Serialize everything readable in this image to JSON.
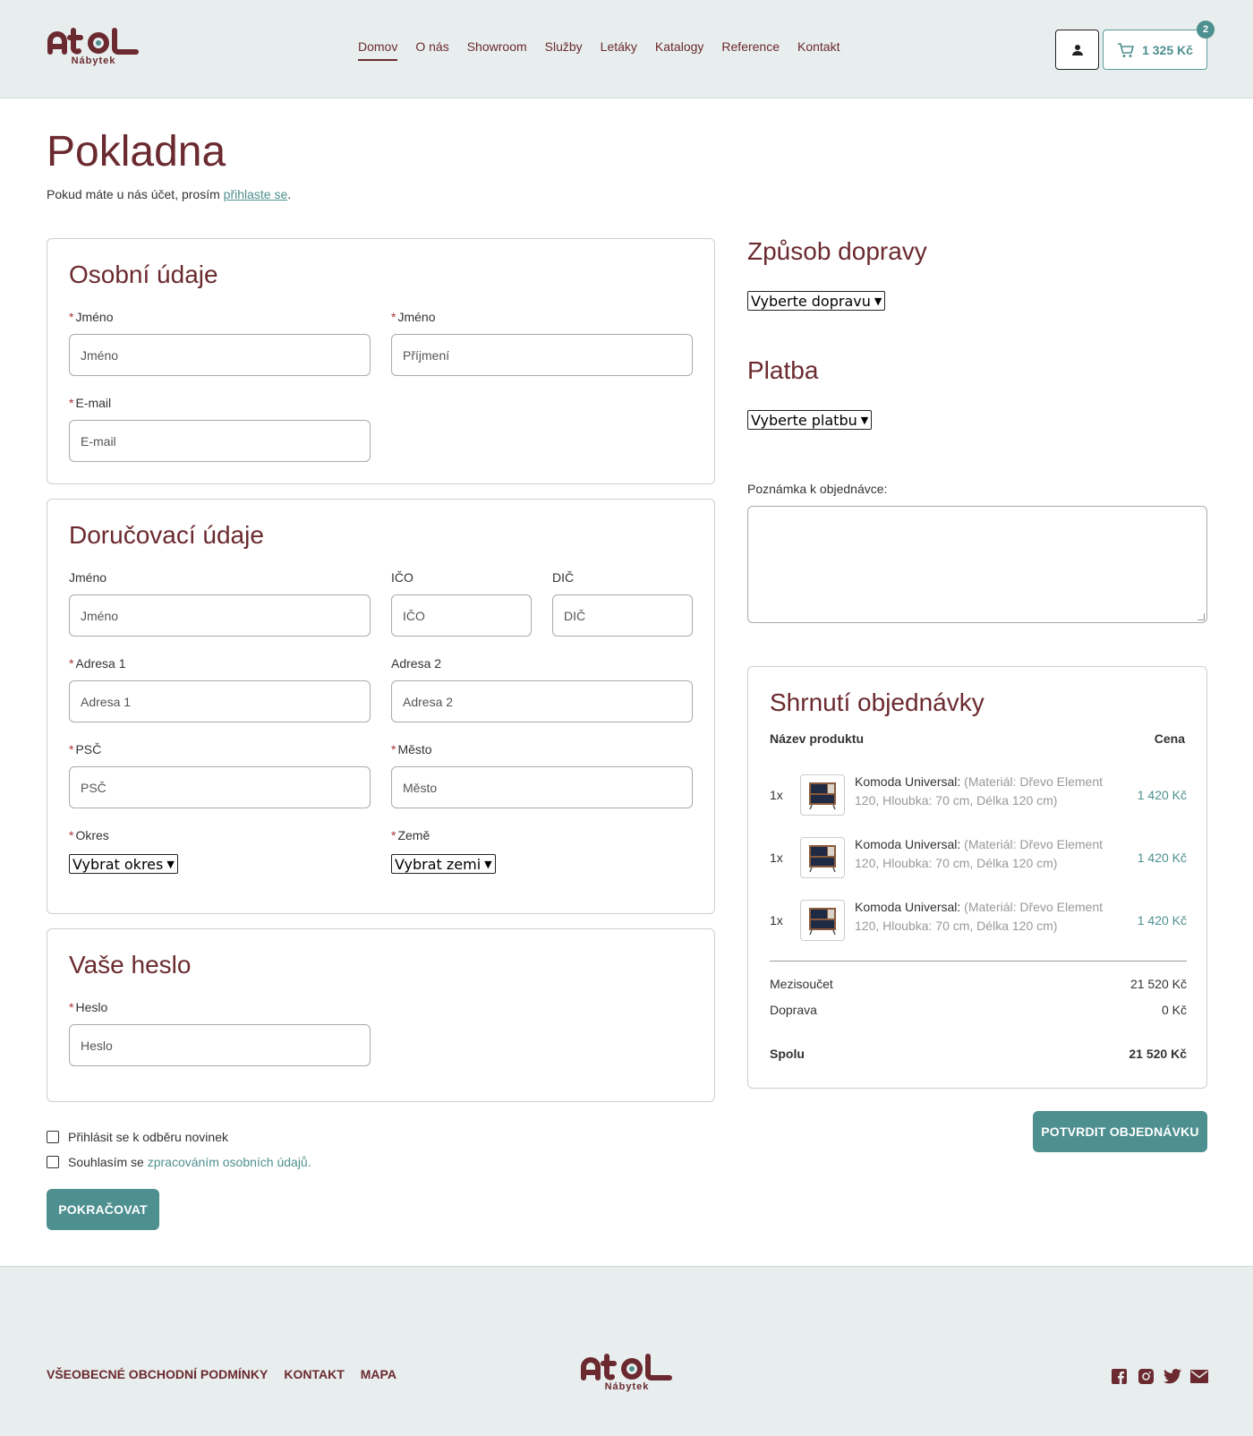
{
  "brand": {
    "logo_text": "AtOL",
    "logo_sub": "Nábytek",
    "color": "#6b2a2f",
    "accent": "#4e8f8f"
  },
  "nav": [
    {
      "label": "Domov",
      "active": true
    },
    {
      "label": "O nás"
    },
    {
      "label": "Showroom"
    },
    {
      "label": "Služby"
    },
    {
      "label": "Letáky"
    },
    {
      "label": "Katalogy"
    },
    {
      "label": "Reference"
    },
    {
      "label": "Kontakt"
    }
  ],
  "header": {
    "cart_total": "1 325 Kč",
    "cart_count": "2",
    "user_icon": "user-icon",
    "cart_icon": "cart-icon"
  },
  "page": {
    "title": "Pokladna",
    "login_hint_prefix": "Pokud máte u nás účet, prosím ",
    "login_link": "přihlaste se",
    "login_hint_suffix": "."
  },
  "personal": {
    "title": "Osobní údaje",
    "first_name_label": "Jméno",
    "first_name_placeholder": "Jméno",
    "last_name_label": "Jméno",
    "last_name_placeholder": "Příjmení",
    "email_label": "E-mail",
    "email_placeholder": "E-mail"
  },
  "delivery": {
    "title": "Doručovací údaje",
    "name_label": "Jméno",
    "name_placeholder": "Jméno",
    "ico_label": "IČO",
    "ico_placeholder": "IČO",
    "dic_label": "DIČ",
    "dic_placeholder": "DIČ",
    "addr1_label": "Adresa 1",
    "addr1_placeholder": "Adresa 1",
    "addr2_label": "Adresa 2",
    "addr2_placeholder": "Adresa 2",
    "psc_label": "PSČ",
    "psc_placeholder": "PSČ",
    "city_label": "Město",
    "city_placeholder": "Město",
    "district_label": "Okres",
    "district_value": "Vybrat okres",
    "country_label": "Země",
    "country_value": "Vybrat zemi"
  },
  "password": {
    "title": "Vaše heslo",
    "label": "Heslo",
    "placeholder": "Heslo"
  },
  "checks": {
    "newsletter": "Přihlásit se k odběru novinek",
    "consent_prefix": "Souhlasím se ",
    "consent_link": "zpracováním osobních údajů."
  },
  "continue_button": "POKRAČOVAT",
  "shipping": {
    "title": "Způsob dopravy",
    "select_value": "Vyberte dopravu"
  },
  "payment": {
    "title": "Platba",
    "select_value": "Vyberte platbu"
  },
  "note": {
    "label": "Poznámka k objednávce:"
  },
  "summary": {
    "title": "Shrnutí objednávky",
    "col_product": "Název produktu",
    "col_price": "Cena",
    "items": [
      {
        "qty": "1x",
        "name": "Komoda Universal:",
        "attrs": "(Materiál: Dřevo Element 120, Hloubka: 70 cm, Délka 120 cm)",
        "price": "1 420 Kč"
      },
      {
        "qty": "1x",
        "name": "Komoda Universal:",
        "attrs": "(Materiál: Dřevo Element 120, Hloubka: 70 cm, Délka 120 cm)",
        "price": "1 420 Kč"
      },
      {
        "qty": "1x",
        "name": "Komoda Universal:",
        "attrs": "(Materiál: Dřevo Element 120, Hloubka: 70 cm, Délka 120 cm)",
        "price": "1 420 Kč"
      }
    ],
    "subtotal_label": "Mezisoučet",
    "subtotal_value": "21 520 Kč",
    "shipping_label": "Doprava",
    "shipping_value": "0 Kč",
    "total_label": "Spolu",
    "total_value": "21 520 Kč"
  },
  "confirm_button": "POTVRDIT OBJEDNÁVKU",
  "footer": {
    "links": [
      "VŠEOBECNÉ OBCHODNÍ PODMÍNKY",
      "KONTAKT",
      "MAPA"
    ],
    "socials": [
      "facebook-icon",
      "instagram-icon",
      "twitter-icon",
      "mail-icon"
    ]
  }
}
